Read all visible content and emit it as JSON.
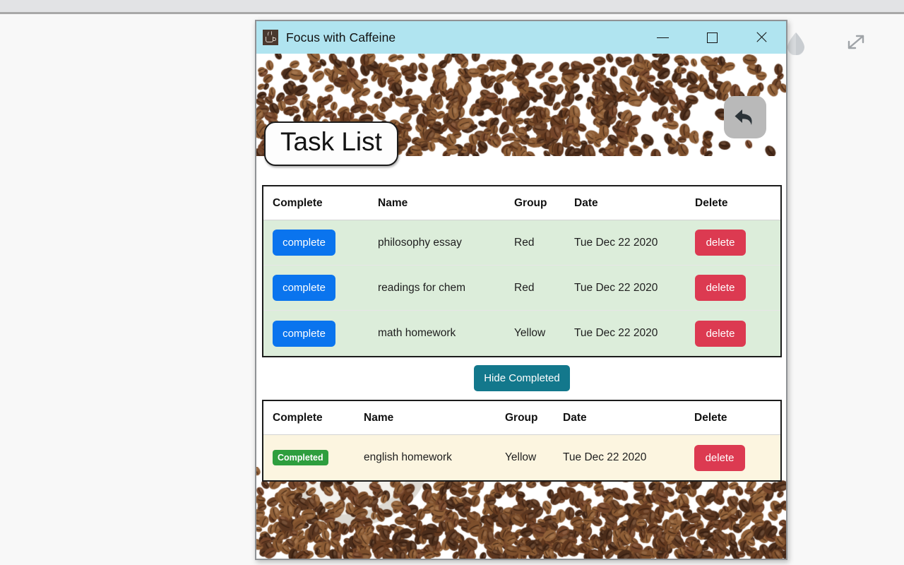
{
  "window": {
    "title": "Focus with Caffeine",
    "icon": "coffee-cup-icon",
    "minimize_label": "—",
    "maximize_label": "□",
    "close_label": "×"
  },
  "page": {
    "title": "Task List",
    "back_icon": "back-arrow-icon"
  },
  "desktop": {
    "contrast_icon": "contrast-droplet-icon",
    "expand_icon": "expand-arrows-icon"
  },
  "toolbar": {
    "hide_completed_label": "Hide Completed",
    "hide_completed_color": "#13788c"
  },
  "colors": {
    "titlebar": "#b0e4f0",
    "complete_button": "#0a74ee",
    "delete_button": "#dc3a51",
    "completed_badge": "#2e9e3e",
    "active_row": "#dcedda",
    "completed_row": "#fcf5e0"
  },
  "active_table": {
    "headers": [
      "Complete",
      "Name",
      "Group",
      "Date",
      "Delete"
    ],
    "rows": [
      {
        "complete_label": "complete",
        "name": "philosophy essay",
        "group": "Red",
        "date": "Tue Dec 22 2020",
        "delete_label": "delete"
      },
      {
        "complete_label": "complete",
        "name": "readings for chem",
        "group": "Red",
        "date": "Tue Dec 22 2020",
        "delete_label": "delete"
      },
      {
        "complete_label": "complete",
        "name": "math homework",
        "group": "Yellow",
        "date": "Tue Dec 22 2020",
        "delete_label": "delete"
      }
    ]
  },
  "completed_table": {
    "headers": [
      "Complete",
      "Name",
      "Group",
      "Date",
      "Delete"
    ],
    "rows": [
      {
        "status_label": "Completed",
        "name": "english homework",
        "group": "Yellow",
        "date": "Tue Dec 22 2020",
        "delete_label": "delete"
      }
    ]
  }
}
